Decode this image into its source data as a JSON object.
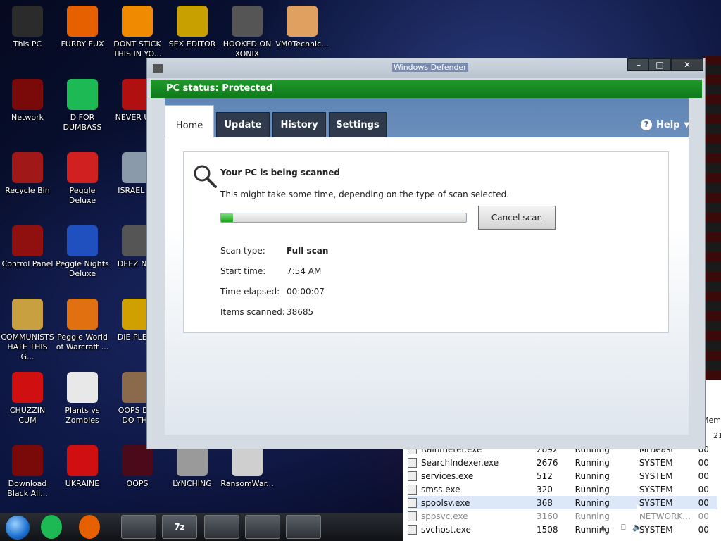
{
  "desktop_icons": [
    {
      "label": "This PC",
      "icon": "monitor-icon",
      "color": "#2b2b2b"
    },
    {
      "label": "FURRY FUX",
      "icon": "firefox-icon",
      "color": "#e66000"
    },
    {
      "label": "DONT STICK\nTHIS IN YO...",
      "icon": "vlc-cone-icon",
      "color": "#f08a00"
    },
    {
      "label": "SEX EDITOR",
      "icon": "hxd-icon",
      "color": "#c8a000"
    },
    {
      "label": "HOOKED ON\nXONIX",
      "icon": "xonix-icon",
      "color": "#555555"
    },
    {
      "label": "VM0Technic...",
      "icon": "doctor-icon",
      "color": "#e0a060"
    },
    {
      "label": "Network",
      "icon": "network-icon",
      "color": "#7a0a0a"
    },
    {
      "label": "D FOR\nDUMBASS",
      "icon": "spotify-icon",
      "color": "#1db954"
    },
    {
      "label": "NEVER USE",
      "icon": "devcpp-icon",
      "color": "#b01010"
    },
    {
      "label": "Recycle Bin",
      "icon": "recycle-bin-icon",
      "color": "#a01818"
    },
    {
      "label": "Peggle Deluxe",
      "icon": "peggle-icon",
      "color": "#d02020"
    },
    {
      "label": "ISRAEL SE",
      "icon": "pipe-icon",
      "color": "#8a9aaa"
    },
    {
      "label": "Control Panel",
      "icon": "control-panel-icon",
      "color": "#901010"
    },
    {
      "label": "Peggle Nights\nDeluxe",
      "icon": "peggle-nights-icon",
      "color": "#2050c0"
    },
    {
      "label": "DEEZ NUT",
      "icon": "windows-stack-icon",
      "color": "#555555"
    },
    {
      "label": "COMMUNISTS\nHATE THIS G...",
      "icon": "money-bag-icon",
      "color": "#c8a040"
    },
    {
      "label": "Peggle World\nof Warcraft ...",
      "icon": "peggle-wow-icon",
      "color": "#e07010"
    },
    {
      "label": "DIE PLEAS",
      "icon": "die-icon",
      "color": "#d0a000"
    },
    {
      "label": "CHUZZIN\nCUM",
      "icon": "chuzzle-icon",
      "color": "#d01010"
    },
    {
      "label": "Plants vs\nZombies",
      "icon": "flower-icon",
      "color": "#e8e8e8"
    },
    {
      "label": "OOPS DID\nDO THA",
      "icon": "portrait-icon",
      "color": "#8a6a4a"
    },
    {
      "label": "Download\nBlack Ali...",
      "icon": "download-icon",
      "color": "#7a0a0a"
    },
    {
      "label": "UKRAINE",
      "icon": "radiation-icon",
      "color": "#d01010"
    },
    {
      "label": "OOPS",
      "icon": "oops-icon",
      "color": "#4a0a1a"
    },
    {
      "label": "LYNCHING",
      "icon": "noose-icon",
      "color": "#9a9a9a"
    },
    {
      "label": "RansomWar...",
      "icon": "skull-icon",
      "color": "#cfcfcf"
    }
  ],
  "taskbar": {
    "items": [
      {
        "icon": "spotify-icon",
        "text": ""
      },
      {
        "icon": "firefox-icon",
        "text": ""
      },
      {
        "icon": "file-explorer-icon",
        "text": ""
      },
      {
        "icon": "7zip-icon",
        "text": "7z"
      },
      {
        "icon": "firewall-icon",
        "text": ""
      },
      {
        "icon": "mask-icon",
        "text": ""
      },
      {
        "icon": "task-manager-icon",
        "text": ""
      }
    ]
  },
  "taskmgr": {
    "header": "Mem",
    "header2": "21",
    "rows": [
      {
        "name": "Rainmeter.exe",
        "pid": "2892",
        "status": "Running",
        "user": "MrBeast",
        "cpu": "00"
      },
      {
        "name": "SearchIndexer.exe",
        "pid": "2676",
        "status": "Running",
        "user": "SYSTEM",
        "cpu": "00"
      },
      {
        "name": "services.exe",
        "pid": "512",
        "status": "Running",
        "user": "SYSTEM",
        "cpu": "00"
      },
      {
        "name": "smss.exe",
        "pid": "320",
        "status": "Running",
        "user": "SYSTEM",
        "cpu": "00"
      },
      {
        "name": "spoolsv.exe",
        "pid": "368",
        "status": "Running",
        "user": "SYSTEM",
        "cpu": "00"
      },
      {
        "name": "sppsvc.exe",
        "pid": "3160",
        "status": "Running",
        "user": "NETWORK...",
        "cpu": "00"
      },
      {
        "name": "svchost.exe",
        "pid": "1508",
        "status": "Running",
        "user": "SYSTEM",
        "cpu": "00"
      }
    ]
  },
  "defender": {
    "window_title": "Windows Defender",
    "status": "PC status: Protected",
    "tabs": [
      "Home",
      "Update",
      "History",
      "Settings"
    ],
    "help_label": "Help",
    "scan_title": "Your PC is being scanned",
    "scan_subtitle": "This might take some time, depending on the type of scan selected.",
    "progress_fraction": 0.05,
    "cancel_label": "Cancel scan",
    "info": [
      {
        "key": "Scan type:",
        "value": "Full scan",
        "bold": true
      },
      {
        "key": "Start time:",
        "value": "7:54 AM",
        "bold": false
      },
      {
        "key": "Time elapsed:",
        "value": "00:00:07",
        "bold": false
      },
      {
        "key": "Items scanned:",
        "value": "38685",
        "bold": false
      }
    ],
    "colors": {
      "status_green": "#14881f",
      "tab_dark": "#2f3b4d"
    }
  }
}
